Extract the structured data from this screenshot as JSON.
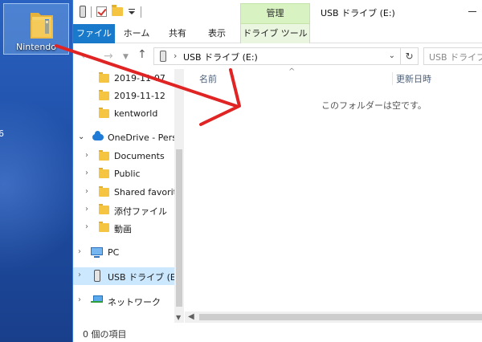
{
  "desktop": {
    "icon_label": "Nintendo",
    "edge_char": "6"
  },
  "titlebar": {
    "manage_tab": "管理",
    "title": "USB ドライブ (E:)"
  },
  "ribbon": {
    "file": "ファイル",
    "home": "ホーム",
    "share": "共有",
    "view": "表示",
    "drive_tools": "ドライブ ツール"
  },
  "address": {
    "path": "USB ドライブ (E:)",
    "search_placeholder": "USB ドライブ (E:)"
  },
  "navpane": {
    "items": [
      {
        "label": "2019-11-07",
        "icon": "folder-icon"
      },
      {
        "label": "2019-11-12",
        "icon": "folder-icon"
      },
      {
        "label": "kentworld",
        "icon": "folder-icon"
      },
      {
        "label": "OneDrive - Perso",
        "icon": "cloud-icon"
      },
      {
        "label": "Documents",
        "icon": "folder-icon"
      },
      {
        "label": "Public",
        "icon": "folder-icon"
      },
      {
        "label": "Shared favorites",
        "icon": "folder-icon"
      },
      {
        "label": "添付ファイル",
        "icon": "folder-icon"
      },
      {
        "label": "動画",
        "icon": "folder-icon"
      },
      {
        "label": "PC",
        "icon": "pc-icon"
      },
      {
        "label": "USB ドライブ (E:)",
        "icon": "usb-drive-icon"
      },
      {
        "label": "ネットワーク",
        "icon": "network-icon"
      }
    ]
  },
  "content": {
    "col_name": "名前",
    "col_date": "更新日時",
    "empty_message": "このフォルダーは空です。"
  },
  "status": {
    "items": "0 個の項目"
  },
  "colors": {
    "file_tab": "#1979ca",
    "manage_tab": "#d9f2c2",
    "selection": "#cce8ff",
    "annotation_arrow": "#e02424",
    "folder": "#f5c542"
  }
}
